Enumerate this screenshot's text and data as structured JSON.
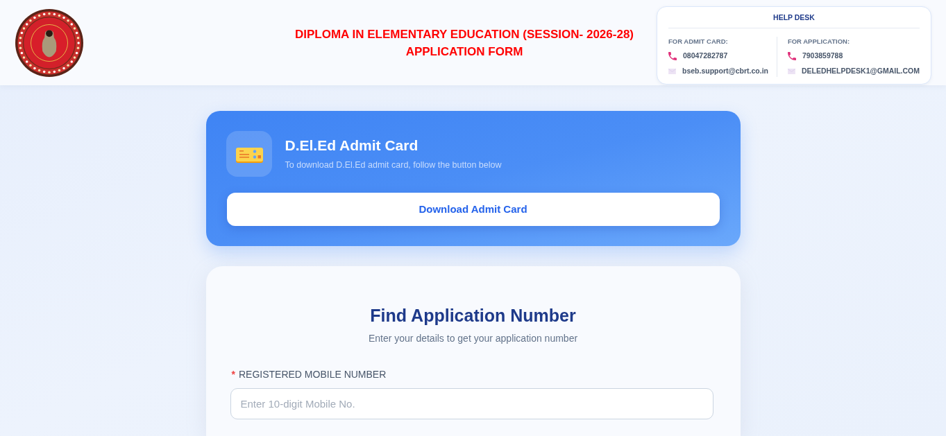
{
  "header": {
    "title_lines": [
      "DIPLOMA IN ELEMENTARY EDUCATION (SESSION- 2026-28)",
      "APPLICATION FORM"
    ],
    "help_desk": {
      "title": "HELP DESK",
      "columns": [
        {
          "heading": "FOR ADMIT CARD:",
          "contacts": [
            {
              "kind": "phone",
              "text": "08047282787"
            },
            {
              "kind": "email",
              "text": "bseb.support@cbrt.co.in"
            }
          ]
        },
        {
          "heading": "FOR APPLICATION:",
          "contacts": [
            {
              "kind": "phone",
              "text": "7903859788"
            },
            {
              "kind": "email",
              "text": "DELEDHELPDESK1@GMAIL.COM"
            }
          ]
        }
      ]
    }
  },
  "admit_card": {
    "title": "D.El.Ed Admit Card",
    "subtitle": "To download D.El.Ed admit card, follow the button below",
    "button": "Download Admit Card"
  },
  "find_application": {
    "title": "Find Application Number",
    "subtitle": "Enter your details to get your application number",
    "fields": [
      {
        "required_mark": "*",
        "label": "REGISTERED MOBILE NUMBER",
        "placeholder": "Enter 10-digit Mobile No."
      }
    ]
  }
}
